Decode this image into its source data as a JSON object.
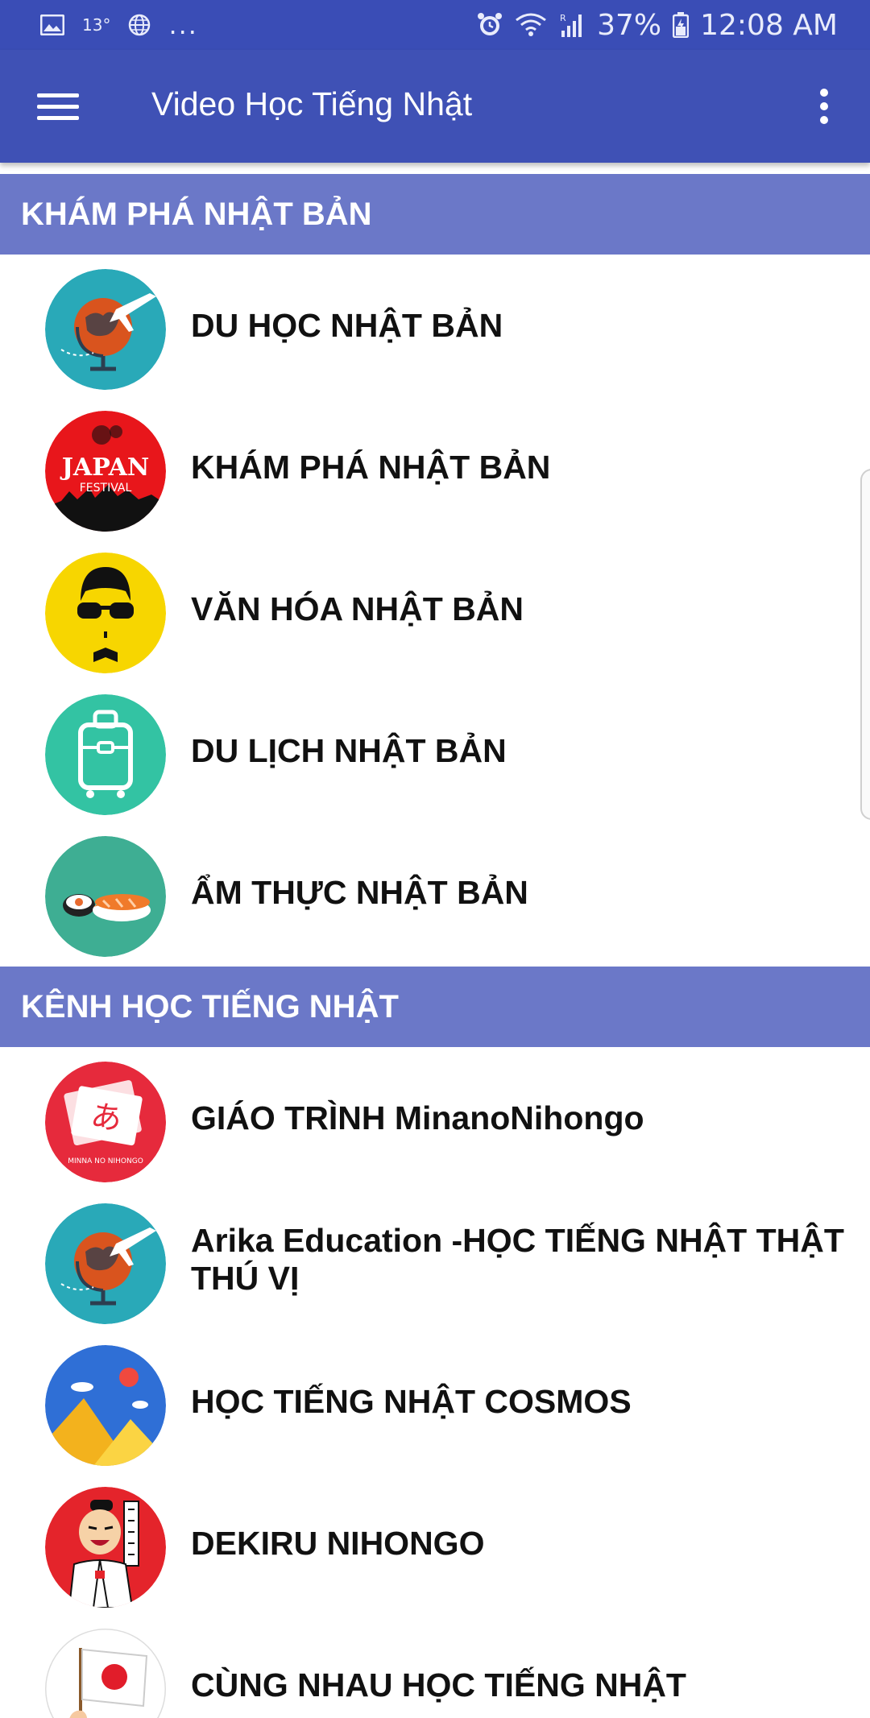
{
  "status_bar": {
    "left": {
      "temp": "13°",
      "more": "..."
    },
    "right": {
      "battery": "37%",
      "time": "12:08 AM",
      "roaming": "R"
    },
    "icons": [
      "gallery-icon",
      "globe-icon",
      "alarm-icon",
      "wifi-icon",
      "signal-icon",
      "battery-icon"
    ]
  },
  "app_bar": {
    "title": "Video Học Tiếng Nhật",
    "menu_icon": "hamburger-menu-icon",
    "overflow_icon": "more-vert-icon",
    "color": "#3f51b5"
  },
  "sections": [
    {
      "title": "KHÁM PHÁ NHẬT BẢN",
      "items": [
        {
          "label": "DU HỌC NHẬT BẢN",
          "icon": "globe-plane-icon"
        },
        {
          "label": "KHÁM PHÁ NHẬT BẢN",
          "icon": "japan-festival-icon"
        },
        {
          "label": "VĂN HÓA NHẬT BẢN",
          "icon": "sunglasses-face-icon"
        },
        {
          "label": "DU LỊCH NHẬT BẢN",
          "icon": "suitcase-icon"
        },
        {
          "label": "ẨM THỰC NHẬT BẢN",
          "icon": "sushi-icon"
        }
      ]
    },
    {
      "title": "KÊNH HỌC TIẾNG NHẬT",
      "items": [
        {
          "label": "GIÁO TRÌNH MinanoNihongo",
          "icon": "minna-no-nihongo-icon",
          "icon_text": "あ",
          "icon_caption": "MINNA NO NIHONGO"
        },
        {
          "label": "Arika Education -HỌC TIẾNG NHẬT THẬT THÚ VỊ",
          "icon": "globe-plane-icon"
        },
        {
          "label": "HỌC TIẾNG NHẬT COSMOS",
          "icon": "mountains-landscape-icon"
        },
        {
          "label": "DEKIRU NIHONGO",
          "icon": "samurai-character-icon"
        },
        {
          "label": "CÙNG NHAU HỌC TIẾNG NHẬT",
          "icon": "japan-flag-hand-icon"
        }
      ]
    }
  ],
  "colors": {
    "status_bar": "#3a4db6",
    "app_bar": "#3f51b5",
    "section_header": "#6b78c8"
  }
}
